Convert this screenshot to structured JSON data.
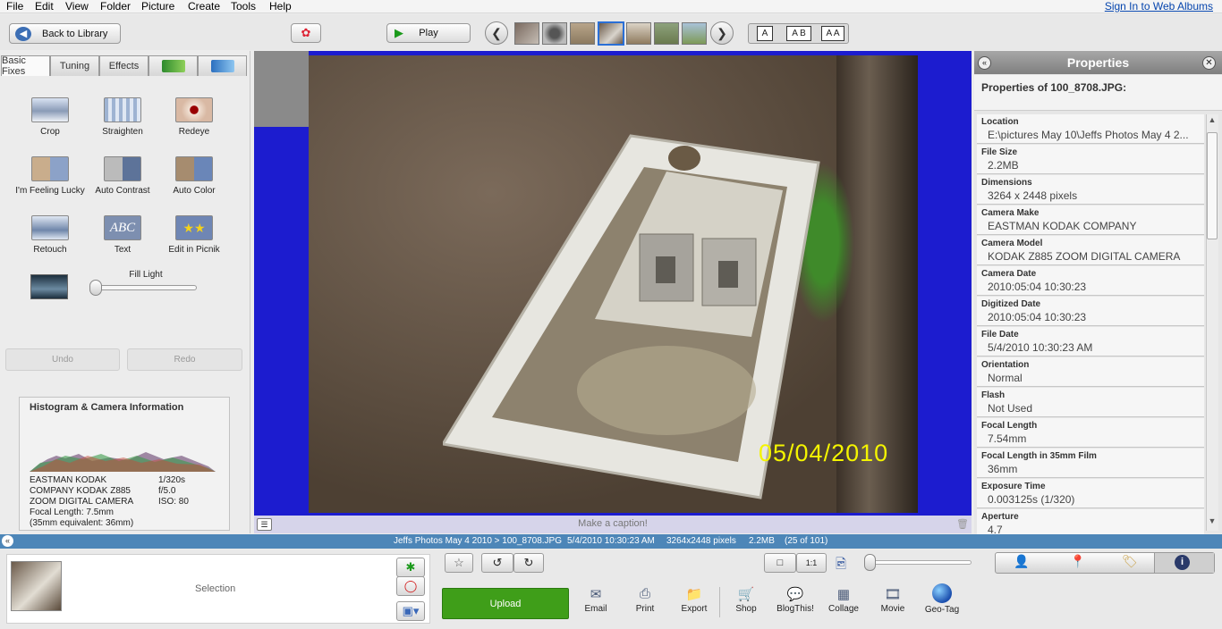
{
  "menu": [
    "File",
    "Edit",
    "View",
    "Folder",
    "Picture",
    "Create",
    "Tools",
    "Help"
  ],
  "sign_in": "Sign In to Web Albums",
  "toolbar": {
    "back": "Back to Library",
    "play": "Play",
    "text_a": "A",
    "text_ab": "A B",
    "text_aa": "A A"
  },
  "tabs": [
    "Basic Fixes",
    "Tuning",
    "Effects"
  ],
  "tools": [
    {
      "label": "Crop",
      "icon": "crop-icon"
    },
    {
      "label": "Straighten",
      "icon": "straighten-icon"
    },
    {
      "label": "Redeye",
      "icon": "redeye-icon"
    },
    {
      "label": "I'm Feeling Lucky",
      "icon": "feeling-lucky-icon"
    },
    {
      "label": "Auto Contrast",
      "icon": "auto-contrast-icon"
    },
    {
      "label": "Auto Color",
      "icon": "auto-color-icon"
    },
    {
      "label": "Retouch",
      "icon": "retouch-icon"
    },
    {
      "label": "Text",
      "icon": "text-icon"
    },
    {
      "label": "Edit in Picnik",
      "icon": "picnik-icon"
    }
  ],
  "fill_light": {
    "label": "Fill Light",
    "value": 0
  },
  "undo": "Undo",
  "redo": "Redo",
  "histogram": {
    "title": "Histogram & Camera Information",
    "camera_lines": [
      "EASTMAN KODAK",
      "COMPANY KODAK Z885",
      "ZOOM DIGITAL CAMERA"
    ],
    "exposure": [
      "1/320s",
      "f/5.0",
      "ISO: 80"
    ],
    "focal": "Focal Length: 7.5mm",
    "equiv": "(35mm equivalent:  36mm)"
  },
  "photo": {
    "date_stamp": "05/04/2010"
  },
  "caption_placeholder": "Make a caption!",
  "properties": {
    "title": "Properties",
    "subtitle": "Properties of 100_8708.JPG:",
    "items": [
      {
        "key": "Location",
        "value": "E:\\pictures May 10\\Jeffs Photos May 4 2..."
      },
      {
        "key": "File Size",
        "value": "2.2MB"
      },
      {
        "key": "Dimensions",
        "value": "3264 x 2448 pixels"
      },
      {
        "key": "Camera Make",
        "value": "EASTMAN KODAK COMPANY"
      },
      {
        "key": "Camera Model",
        "value": "KODAK Z885 ZOOM DIGITAL CAMERA"
      },
      {
        "key": "Camera Date",
        "value": "2010:05:04 10:30:23"
      },
      {
        "key": "Digitized Date",
        "value": "2010:05:04 10:30:23"
      },
      {
        "key": "File Date",
        "value": "5/4/2010 10:30:23 AM"
      },
      {
        "key": "Orientation",
        "value": "Normal"
      },
      {
        "key": "Flash",
        "value": "Not Used"
      },
      {
        "key": "Focal Length",
        "value": "7.54mm"
      },
      {
        "key": "Focal Length in 35mm Film",
        "value": "36mm"
      },
      {
        "key": "Exposure Time",
        "value": "0.003125s (1/320)"
      },
      {
        "key": "Aperture",
        "value": "4.7"
      }
    ]
  },
  "status": {
    "path": "Jeffs Photos May 4 2010 > 100_8708.JPG",
    "datetime": "5/4/2010 10:30:23 AM",
    "pixels": "3264x2448 pixels",
    "size": "2.2MB",
    "position": "(25 of 101)"
  },
  "selection_label": "Selection",
  "upload": "Upload",
  "zoom_1to1": "1:1",
  "actions": [
    "Email",
    "Print",
    "Export",
    "Shop",
    "BlogThis!",
    "Collage",
    "Movie",
    "Geo-Tag"
  ],
  "colors": {
    "upload_green": "#3f9e19",
    "status_blue": "#4d86b8",
    "canvas_blue": "#1c1ccf",
    "date_yellow": "#f4f400"
  }
}
